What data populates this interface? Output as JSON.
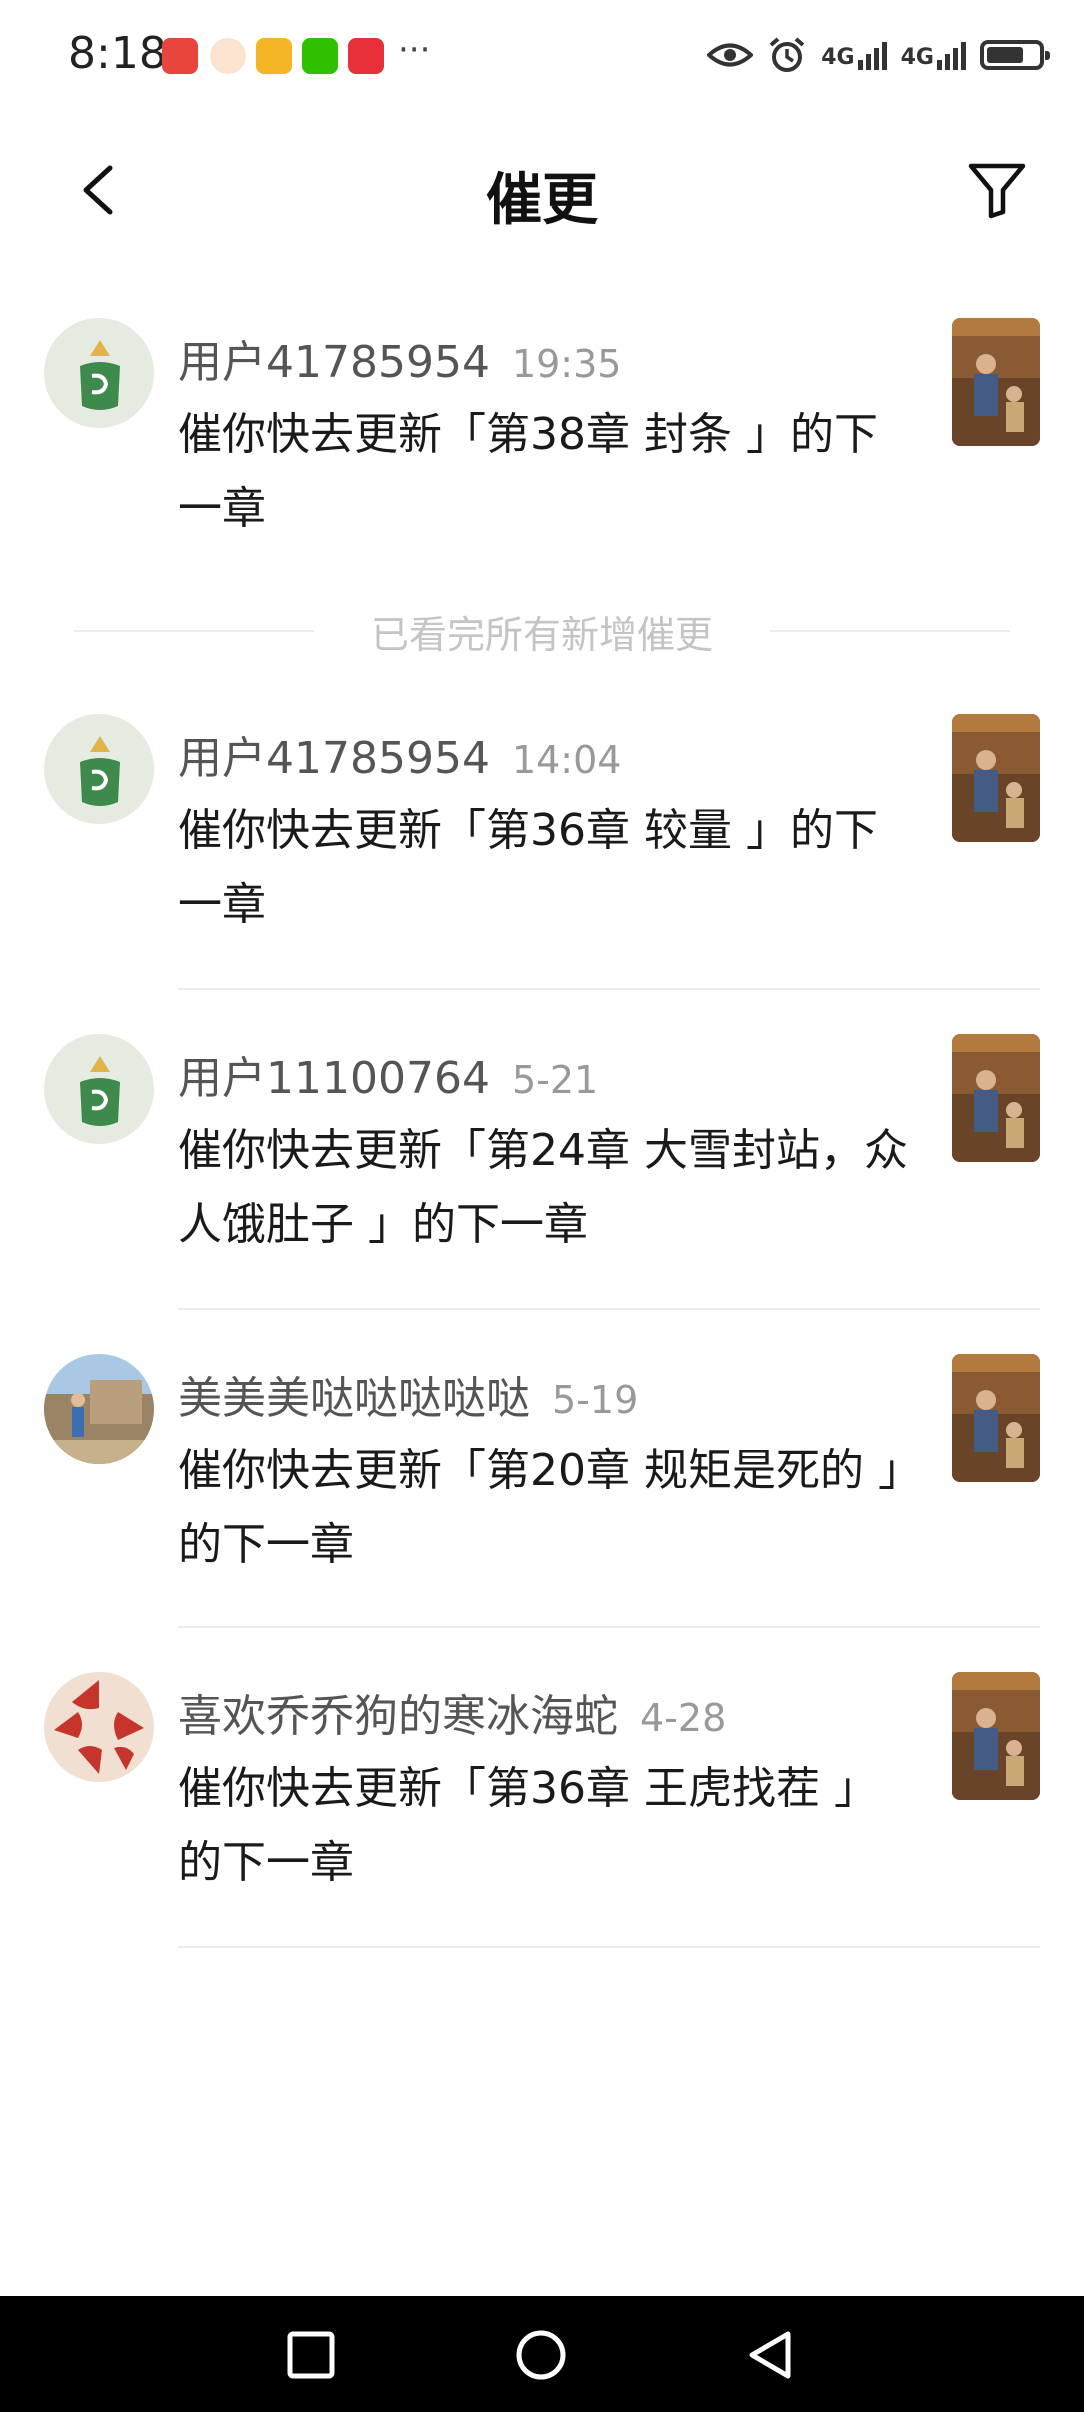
{
  "status_bar": {
    "time": "8:18",
    "more": "···",
    "net1": "4G",
    "net2": "4G",
    "battery_level": 0.75,
    "notification_icons": [
      "huawei-appgallery-icon",
      "profile-icon",
      "weibo-icon",
      "wechat-icon",
      "shopping-icon"
    ],
    "system_icons": [
      "eye-icon",
      "alarm-icon",
      "signal-icon",
      "battery-icon"
    ]
  },
  "header": {
    "title": "催更"
  },
  "items": [
    {
      "user": "用户41785954",
      "time": "19:35",
      "message": "催你快去更新「第38章 封条 」的下一章"
    },
    {
      "user": "用户41785954",
      "time": "14:04",
      "message": "催你快去更新「第36章 较量 」的下一章"
    },
    {
      "user": "用户11100764",
      "time": "5-21",
      "message": "催你快去更新「第24章 大雪封站，众人饿肚子 」的下一章"
    },
    {
      "user": "美美美哒哒哒哒哒",
      "time": "5-19",
      "message": "催你快去更新「第20章 规矩是死的 」的下一章"
    },
    {
      "user": "喜欢乔乔狗的寒冰海蛇",
      "time": "4-28",
      "message": "催你快去更新「第36章 王虎找茬 」的下一章"
    }
  ],
  "separator_text": "已看完所有新增催更",
  "colors": {
    "background": "#ffffff",
    "text_primary": "#1a1a1a",
    "text_secondary": "#555555",
    "text_muted": "#999999",
    "divider": "#ececec",
    "nav_bar": "#000000"
  }
}
